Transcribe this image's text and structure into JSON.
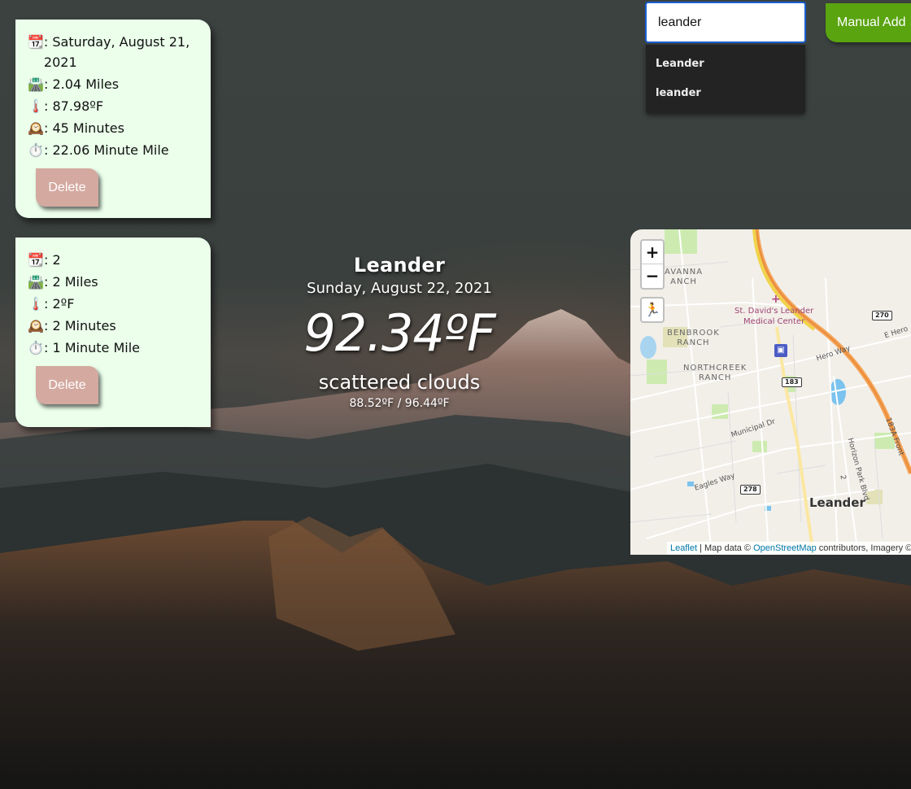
{
  "runs": [
    {
      "date_icon": "📆",
      "date": ": Saturday, August 21, 2021",
      "distance_icon": "🛣️",
      "distance": ": 2.04 Miles",
      "temp_icon": "🌡️",
      "temp": ": 87.98ºF",
      "duration_icon": "🕰️",
      "duration": ": 45 Minutes",
      "pace_icon": "⏱️",
      "pace": ": 22.06 Minute Mile",
      "delete_label": "Delete"
    },
    {
      "date_icon": "📆",
      "date": ": 2",
      "distance_icon": "🛣️",
      "distance": ": 2 Miles",
      "temp_icon": "🌡️",
      "temp": ": 2ºF",
      "duration_icon": "🕰️",
      "duration": ": 2 Minutes",
      "pace_icon": "⏱️",
      "pace": ": 1 Minute Mile",
      "delete_label": "Delete"
    }
  ],
  "weather": {
    "city": "Leander",
    "date": "Sunday, August 22, 2021",
    "temp": "92.34ºF",
    "description": "scattered clouds",
    "range": "88.52ºF / 96.44ºF"
  },
  "search": {
    "value": "leander",
    "suggestions": [
      "Leander",
      "leander"
    ]
  },
  "manual_add_label": "Manual Add",
  "map": {
    "zoom_in": "+",
    "zoom_out": "−",
    "pegman_icon": "🏃",
    "labels": {
      "savanna": "AVANNA\nANCH",
      "hospital": "St. David's Leander\nMedical Center",
      "benbrook": "BENBROOK\nRANCH",
      "northcreek": "NORTHCREEK\nRANCH",
      "hero_way": "Hero Way",
      "e_hero": "E Hero",
      "municipal": "Municipal Dr",
      "eagles": "Eagles Way",
      "horizon": "Horizon Park Blvd",
      "frontage": "183A Front",
      "city": "Leander",
      "two": "2"
    },
    "shields": {
      "s270": "270",
      "s183": "183",
      "s278": "278"
    },
    "attribution": {
      "leaflet": "Leaflet",
      "sep": " | Map data © ",
      "osm": "OpenStreetMap",
      "rest": " contributors, Imagery ©"
    }
  }
}
